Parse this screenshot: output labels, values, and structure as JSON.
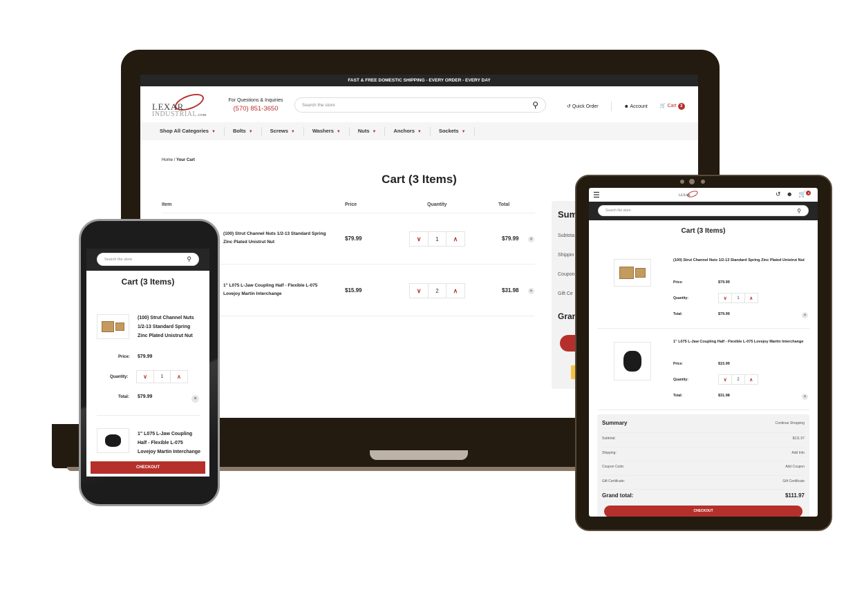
{
  "brand": {
    "logo_line1": "LEXAR",
    "logo_line2": "INDUSTRIAL",
    "logo_suffix": ".com",
    "accent_color": "#b5302b",
    "dark_color": "#262626"
  },
  "banner": "FAST & FREE DOMESTIC SHIPPING - EVERY ORDER - EVERY DAY",
  "contact": {
    "label": "For Questions & Inquiries",
    "phone": "(570) 851-3650"
  },
  "search": {
    "placeholder": "Search the store",
    "icon": "search-icon"
  },
  "header_actions": {
    "quick_order": "Quick Order",
    "account": "Account",
    "cart": "Cart",
    "cart_count": "3"
  },
  "nav": [
    "Shop All Categories",
    "Bolts",
    "Screws",
    "Washers",
    "Nuts",
    "Anchors",
    "Sockets"
  ],
  "breadcrumb": {
    "home": "Home",
    "sep": "/",
    "current": "Your Cart"
  },
  "cart": {
    "title": "Cart (3 Items)",
    "columns": {
      "item": "Item",
      "price": "Price",
      "quantity": "Quantity",
      "total": "Total"
    },
    "labels": {
      "price": "Price:",
      "quantity": "Quantity:",
      "total": "Total:"
    },
    "items": [
      {
        "name": "(100) Strut Channel Nuts 1/2-13 Standard Spring Zinc Plated Unistrut Nut",
        "price": "$79.99",
        "quantity": "1",
        "total": "$79.99"
      },
      {
        "name": "1\" L075 L-Jaw Coupling Half - Flexible L-075 Lovejoy Martin Interchange",
        "price": "$15.99",
        "quantity": "2",
        "total": "$31.98"
      }
    ]
  },
  "summary": {
    "title": "Summary",
    "continue": "Continue Shopping",
    "rows": [
      {
        "label": "Subtotal:",
        "value": "$111.97"
      },
      {
        "label": "Shipping:",
        "value": "Add Info"
      },
      {
        "label": "Coupon Code:",
        "value": "Add Coupon"
      },
      {
        "label": "Gift Certificate:",
        "value": "Gift Certificate"
      }
    ],
    "grand_label": "Grand total:",
    "grand_value": "$111.97",
    "laptop_rows": [
      "Subtota",
      "Shippin",
      "Coupon",
      "Gift Ce"
    ],
    "laptop_title": "Sum",
    "laptop_grand": "Gran"
  },
  "checkout": "CHECKOUT"
}
